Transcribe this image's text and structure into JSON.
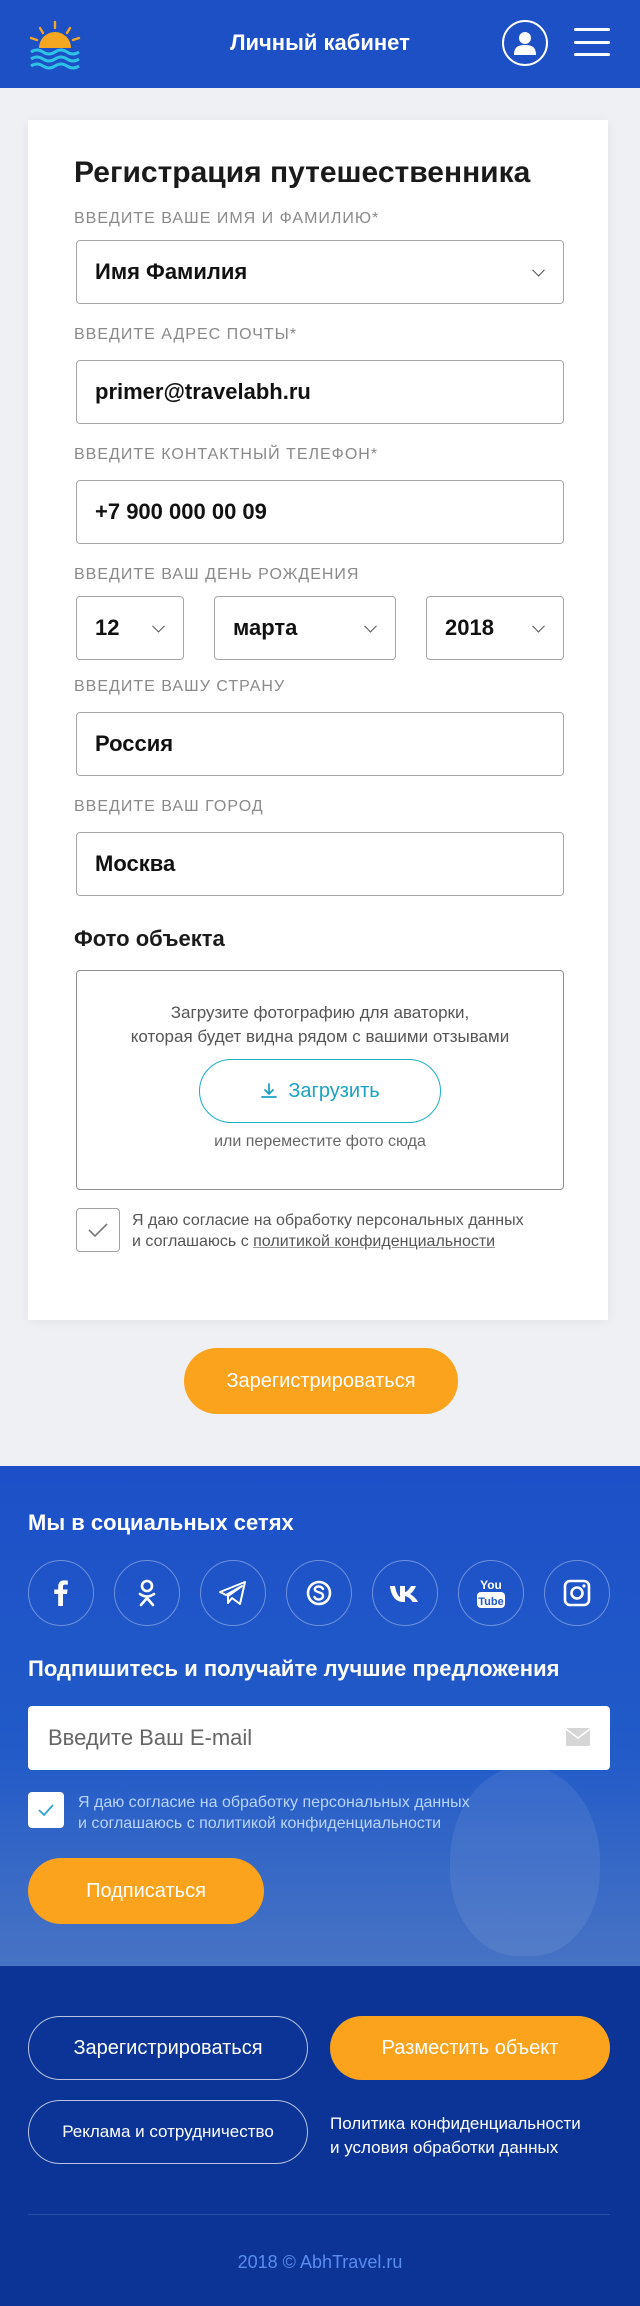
{
  "header": {
    "title": "Личный кабинет",
    "logo_icon": "sun-over-waves-logo",
    "profile_icon": "user-icon",
    "menu_icon": "hamburger-icon"
  },
  "form": {
    "title": "Регистрация путешественника",
    "name": {
      "label": "Введите ваше имя и фамилию*",
      "value": "Имя Фамилия"
    },
    "email": {
      "label": "Введите адрес почты*",
      "value": "primer@travelabh.ru"
    },
    "phone": {
      "label": "Введите контактный телефон*",
      "value": "+7 900 000 00 09"
    },
    "birthday": {
      "label": "Введите ваш день рождения",
      "day": "12",
      "month": "марта",
      "year": "2018"
    },
    "country": {
      "label": "Введите вашу страну",
      "value": "Россия"
    },
    "city": {
      "label": "Введите ваш город",
      "value": "Москва"
    },
    "photo": {
      "title": "Фото объекта",
      "text_line1": "Загрузите фотографию для аватoрки,",
      "text_line2": "которая будет видна рядом с вашими отзывами",
      "upload_label": "Загрузить",
      "hint": "или переместите фото сюда"
    },
    "consent": {
      "line1": "Я даю согласие на обработку персональных данных",
      "line2_prefix": "и соглашаюсь с ",
      "link": "политикой конфиденциальности",
      "checked": true
    },
    "submit_label": "Зарегистрироваться"
  },
  "social": {
    "title": "Мы в социальных сетях",
    "networks": [
      "facebook-icon",
      "odnoklassniki-icon",
      "telegram-icon",
      "skype-icon",
      "vk-icon",
      "youtube-icon",
      "instagram-icon"
    ],
    "subscribe_title": "Подпишитесь и получайте лучшие предложения",
    "email_placeholder": "Введите Ваш E-mail",
    "consent_line1": "Я даю согласие на обработку персональных данных",
    "consent_line2": "и соглашаюсь с политикой конфиденциальности",
    "subscribe_label": "Подписаться"
  },
  "footer": {
    "register_label": "Зарегистрироваться",
    "place_label": "Разместить объект",
    "ads_label": "Реклама и сотрудничество",
    "policy_line1": "Политика конфиденциальности",
    "policy_line2": "и условия обработки данных",
    "copyright": "2018 © AbhTravel.ru"
  },
  "colors": {
    "brand_blue": "#1d4fc5",
    "footer_blue": "#0b3496",
    "accent_orange": "#fba31c",
    "teal": "#1aa3c2"
  }
}
